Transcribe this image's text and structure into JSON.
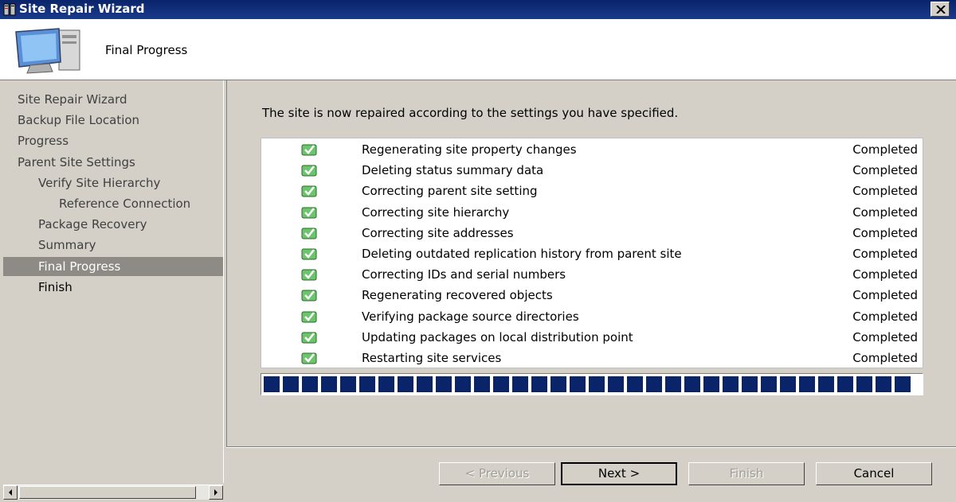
{
  "window": {
    "title": "Site Repair Wizard"
  },
  "header": {
    "title": "Final Progress"
  },
  "sidebar": {
    "items": [
      {
        "label": "Site Repair Wizard",
        "indent": 0,
        "state": "normal"
      },
      {
        "label": "Backup File Location",
        "indent": 0,
        "state": "normal"
      },
      {
        "label": "Progress",
        "indent": 0,
        "state": "normal"
      },
      {
        "label": "Parent Site Settings",
        "indent": 0,
        "state": "normal"
      },
      {
        "label": "Verify Site Hierarchy",
        "indent": 1,
        "state": "normal"
      },
      {
        "label": "Reference Connection",
        "indent": 2,
        "state": "normal"
      },
      {
        "label": "Package Recovery",
        "indent": 1,
        "state": "normal"
      },
      {
        "label": "Summary",
        "indent": 1,
        "state": "normal"
      },
      {
        "label": "Final Progress",
        "indent": 1,
        "state": "active"
      },
      {
        "label": "Finish",
        "indent": 1,
        "state": "bold"
      }
    ]
  },
  "main": {
    "intro": "The site is now repaired according to the settings you have specified.",
    "tasks": [
      {
        "name": "Regenerating site property changes",
        "status": "Completed"
      },
      {
        "name": "Deleting status summary data",
        "status": "Completed"
      },
      {
        "name": "Correcting parent site setting",
        "status": "Completed"
      },
      {
        "name": "Correcting site hierarchy",
        "status": "Completed"
      },
      {
        "name": "Correcting site addresses",
        "status": "Completed"
      },
      {
        "name": "Deleting outdated replication history from parent site",
        "status": "Completed"
      },
      {
        "name": "Correcting IDs and serial numbers",
        "status": "Completed"
      },
      {
        "name": "Regenerating recovered objects",
        "status": "Completed"
      },
      {
        "name": "Verifying package source directories",
        "status": "Completed"
      },
      {
        "name": "Updating packages on local distribution point",
        "status": "Completed"
      },
      {
        "name": "Restarting site services",
        "status": "Completed"
      }
    ],
    "progress": {
      "percent": 100,
      "block_color": "#0a246a"
    }
  },
  "buttons": {
    "previous": "< Previous",
    "next": "Next >",
    "finish": "Finish",
    "cancel": "Cancel"
  },
  "icons": {
    "app": "server-icon",
    "close": "close-icon",
    "computer": "computer-icon",
    "task": "check-icon"
  },
  "colors": {
    "titlebar": "#0a246a",
    "active_item": "#8e8a86",
    "check": "#3aa83a"
  }
}
